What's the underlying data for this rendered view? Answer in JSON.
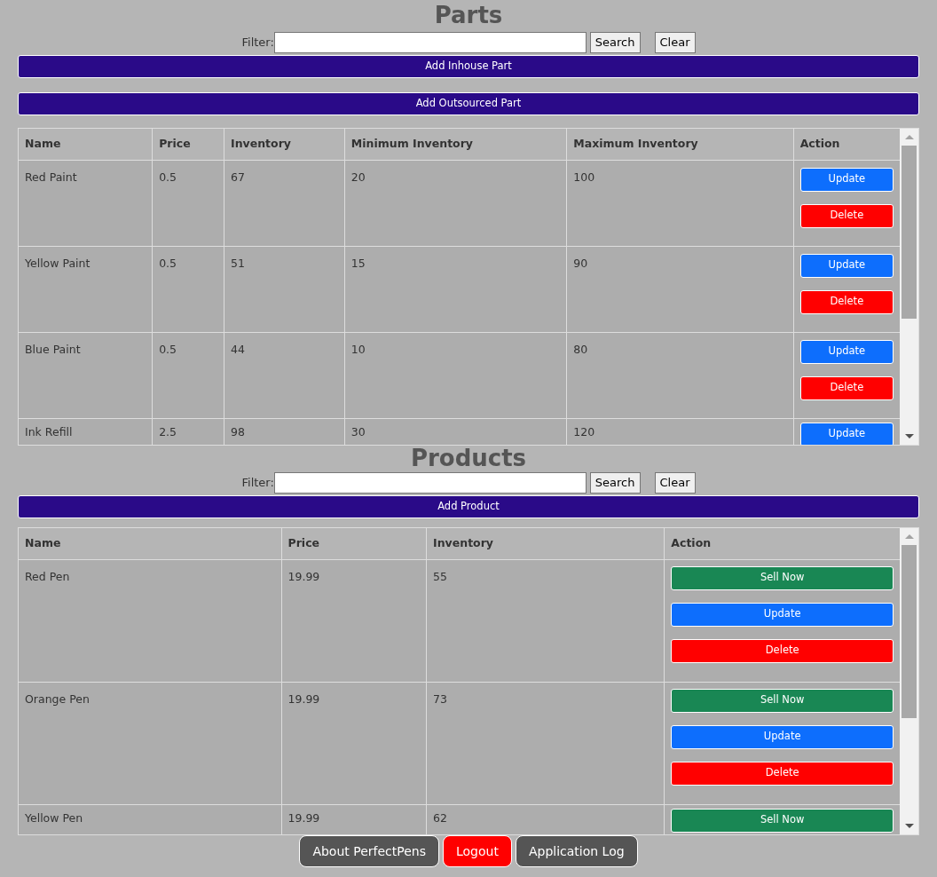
{
  "parts": {
    "title": "Parts",
    "filter_label": "Filter:",
    "search_button": "Search",
    "clear_button": "Clear",
    "add_buttons": [
      "Add Inhouse Part",
      "Add Outsourced Part"
    ],
    "table": {
      "columns": [
        "Name",
        "Price",
        "Inventory",
        "Minimum Inventory",
        "Maximum Inventory",
        "Action"
      ],
      "rows": [
        {
          "cells": [
            "Red Paint",
            "0.5",
            "67",
            "20",
            "100"
          ],
          "actions": [
            {
              "kind": "update",
              "label": "Update"
            },
            {
              "kind": "delete",
              "label": "Delete"
            }
          ]
        },
        {
          "cells": [
            "Yellow Paint",
            "0.5",
            "51",
            "15",
            "90"
          ],
          "actions": [
            {
              "kind": "update",
              "label": "Update"
            },
            {
              "kind": "delete",
              "label": "Delete"
            }
          ]
        },
        {
          "cells": [
            "Blue Paint",
            "0.5",
            "44",
            "10",
            "80"
          ],
          "actions": [
            {
              "kind": "update",
              "label": "Update"
            },
            {
              "kind": "delete",
              "label": "Delete"
            }
          ]
        },
        {
          "cells": [
            "Ink Refill",
            "2.5",
            "98",
            "30",
            "120"
          ],
          "actions": [
            {
              "kind": "update",
              "label": "Update"
            }
          ]
        }
      ]
    }
  },
  "products": {
    "title": "Products",
    "filter_label": "Filter:",
    "search_button": "Search",
    "clear_button": "Clear",
    "add_buttons": [
      "Add Product"
    ],
    "table": {
      "columns": [
        "Name",
        "Price",
        "Inventory",
        "Action"
      ],
      "rows": [
        {
          "cells": [
            "Red Pen",
            "19.99",
            "55"
          ],
          "actions": [
            {
              "kind": "sell",
              "label": "Sell Now"
            },
            {
              "kind": "update",
              "label": "Update"
            },
            {
              "kind": "delete",
              "label": "Delete"
            }
          ]
        },
        {
          "cells": [
            "Orange Pen",
            "19.99",
            "73"
          ],
          "actions": [
            {
              "kind": "sell",
              "label": "Sell Now"
            },
            {
              "kind": "update",
              "label": "Update"
            },
            {
              "kind": "delete",
              "label": "Delete"
            }
          ]
        },
        {
          "cells": [
            "Yellow Pen",
            "19.99",
            "62"
          ],
          "actions": [
            {
              "kind": "sell",
              "label": "Sell Now"
            }
          ]
        }
      ]
    }
  },
  "footer_buttons": [
    {
      "kind": "dark",
      "label": "About PerfectPens"
    },
    {
      "kind": "danger",
      "label": "Logout"
    },
    {
      "kind": "dark",
      "label": "Application Log"
    }
  ]
}
